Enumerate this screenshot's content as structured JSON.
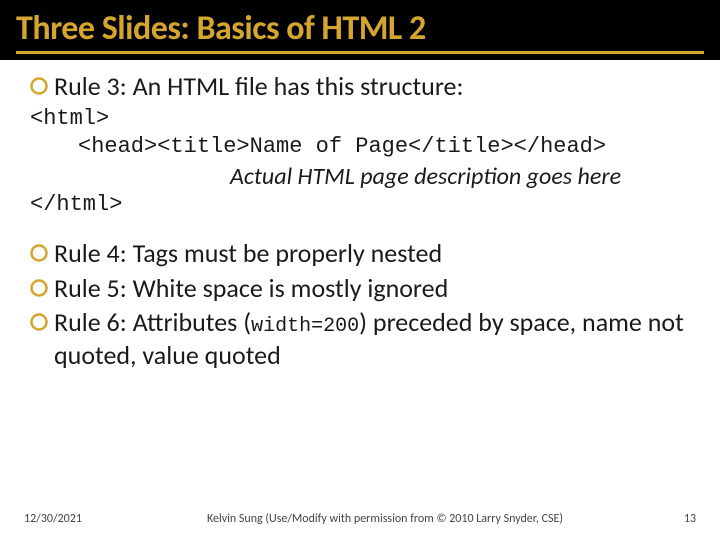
{
  "title": "Three Slides: Basics of HTML  2",
  "rule3": "Rule 3: An HTML file has this structure:",
  "code": {
    "l1": "<html>",
    "l2": "<head><title>Name of Page</title></head>",
    "l3": "Actual HTML page description goes here",
    "l4": "</html>"
  },
  "rule4": "Rule 4: Tags must be properly nested",
  "rule5": "Rule 5: White space is mostly ignored",
  "rule6a": "Rule 6: Attributes (",
  "rule6code": "width=200",
  "rule6b": ") preceded by space, name not quoted, value quoted",
  "footer": {
    "date": "12/30/2021",
    "credit": "Kelvin Sung (Use/Modify with permission from © 2010 Larry Snyder, CSE)",
    "page": "13"
  },
  "colors": {
    "accent": "#d4a52f"
  }
}
